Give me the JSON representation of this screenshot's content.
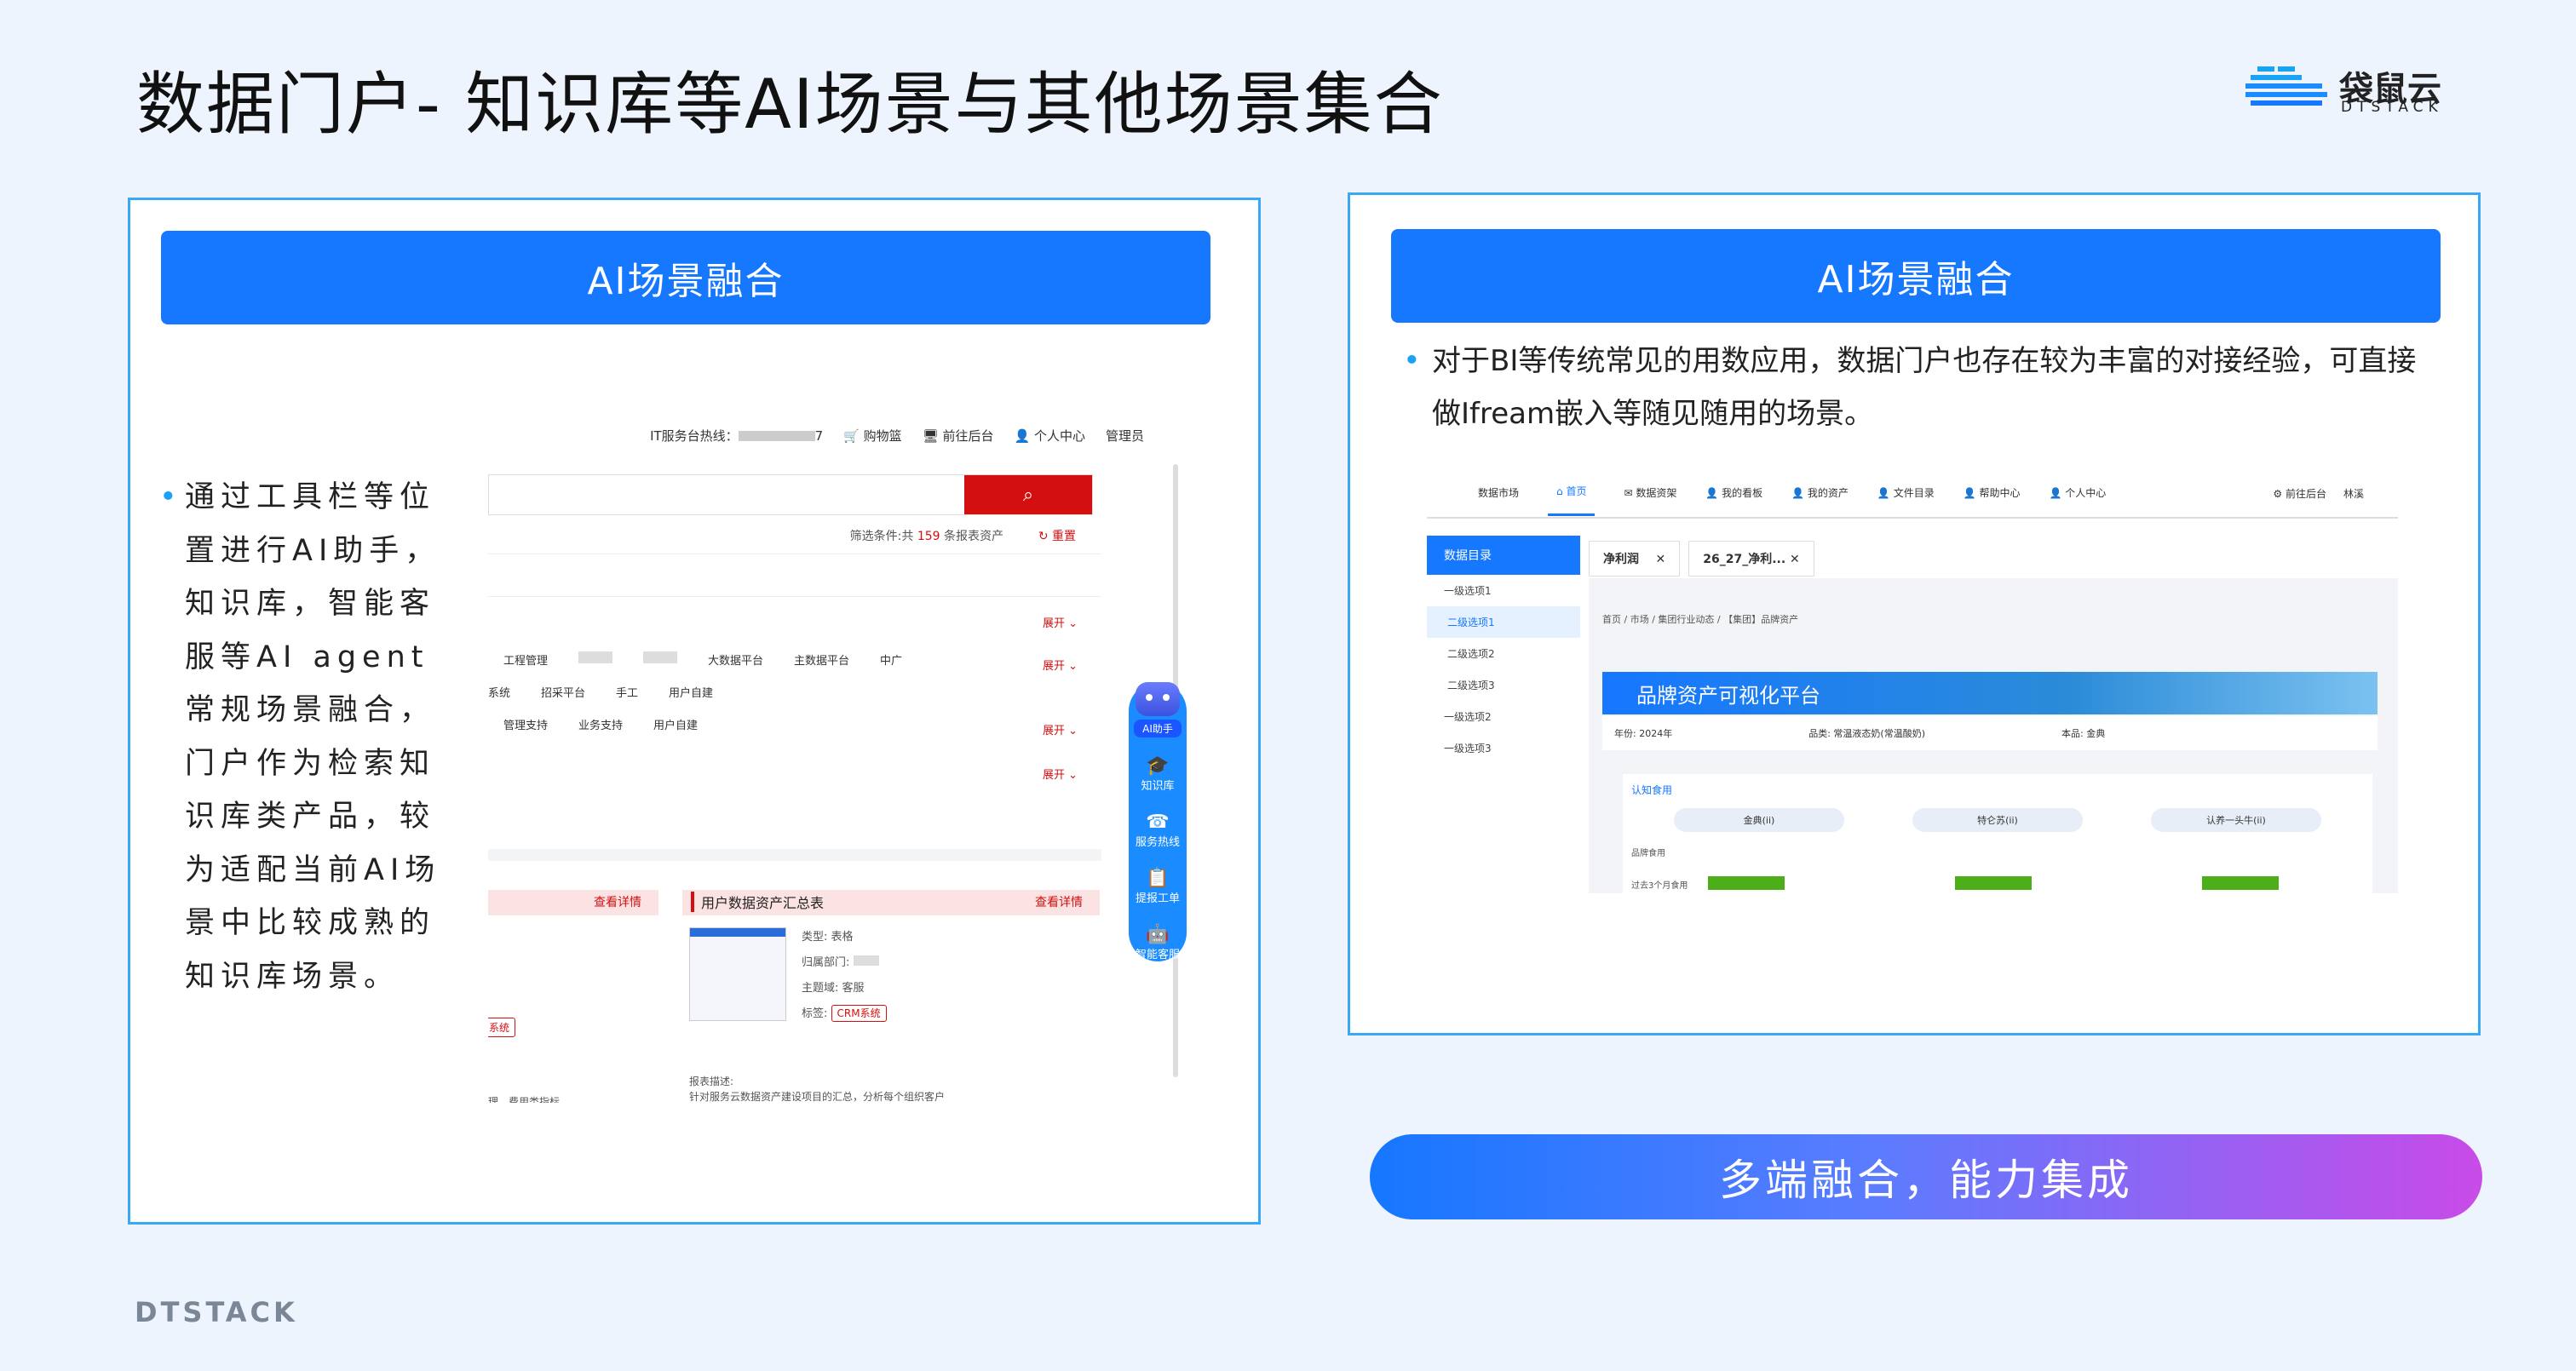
{
  "page": {
    "title": "数据门户- 知识库等AI场景与其他场景集合",
    "brand": {
      "name": "袋鼠云",
      "sub": "DTSTACK"
    },
    "footer_brand": "DTSTACK"
  },
  "left_panel": {
    "banner": "AI场景融合",
    "bullet": "通过工具栏等位置进行AI助手，知识库，智能客服等AI agent常规场景融合，门户作为检索知识库类产品，较为适配当前AI场景中比较成熟的知识库场景。",
    "screenshot": {
      "topbar": {
        "hotline": "IT服务台热线：",
        "hotline_tail": "7",
        "cart": "购物篮",
        "backend": "前往后台",
        "user_center": "个人中心",
        "admin": "管理员"
      },
      "filter_prefix": "筛选条件:共 ",
      "filter_count": "159",
      "filter_suffix": " 条报表资产",
      "reset": "重置",
      "expand": "展开",
      "rows": [
        [
          "工程管理",
          "大数据平台",
          "主数据平台",
          "中广"
        ],
        [
          "系统",
          "招采平台",
          "手工",
          "用户自建"
        ],
        [
          "管理支持",
          "业务支持",
          "用户自建"
        ]
      ],
      "card_link": "查看详情",
      "card_title": "用户数据资产汇总表",
      "meta_type_label": "类型:",
      "meta_type": "表格",
      "meta_dept_label": "归属部门:",
      "meta_domain_label": "主题域:",
      "meta_domain": "客服",
      "meta_tag_label": "标签:",
      "meta_tag": "CRM系统",
      "tag_left": "系统",
      "desc_label": "报表描述:",
      "desc_text": "针对服务云数据资产建设项目的汇总，分析每个组织客户",
      "left_tail": "理、费用类指标"
    },
    "ai_toolbar": {
      "assistant": "AI助手",
      "items": [
        {
          "icon": "graduation-cap-icon",
          "glyph": "🎓",
          "label": "知识库"
        },
        {
          "icon": "phone-icon",
          "glyph": "☎",
          "label": "服务热线"
        },
        {
          "icon": "ticket-icon",
          "glyph": "📋",
          "label": "提报工单"
        },
        {
          "icon": "robot-icon",
          "glyph": "🤖",
          "label": "智能客服"
        }
      ]
    }
  },
  "right_panel": {
    "banner": "AI场景融合",
    "bullet": "对于BI等传统常见的用数应用，数据门户也存在较为丰富的对接经验，可直接做Ifream嵌入等随见随用的场景。",
    "screenshot": {
      "nav": [
        "数据市场",
        "首页",
        "数据资架",
        "我的看板",
        "我的资产",
        "文件目录",
        "帮助中心",
        "个人中心"
      ],
      "nav_right": [
        "前往后台",
        "林溪"
      ],
      "sidebar_title": "数据目录",
      "sidebar_items": [
        "一级选项1",
        "二级选项1",
        "二级选项2",
        "二级选项3",
        "一级选项2",
        "一级选项3"
      ],
      "tabs": [
        "净利润",
        "26_27_净利..."
      ],
      "breadcrumb": "首页 / 市场 / 集团行业动态 / 【集团】品牌资产",
      "dashboard_title": "品牌资产可视化平台",
      "filters": [
        "年份: 2024年",
        "品类: 常温液态奶(常温酸奶)",
        "本品: 金典"
      ],
      "card_title": "认知食用",
      "pills": [
        "金典(ii)",
        "特仑苏(ii)",
        "认养一头牛(ii)"
      ],
      "row_labels": [
        "品牌食用",
        "过去3个月食用"
      ]
    }
  },
  "bottom_button": "多端融合，能力集成"
}
